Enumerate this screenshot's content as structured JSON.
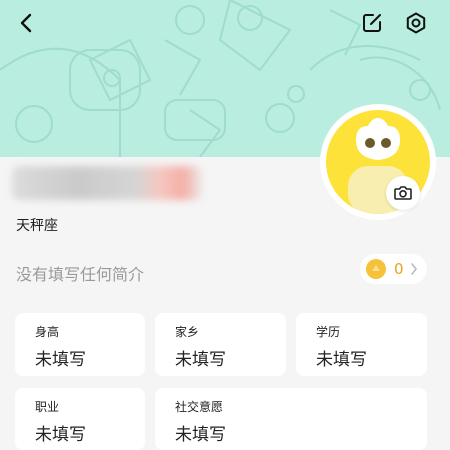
{
  "header": {
    "back_icon": "chevron-left-icon",
    "edit_icon": "edit-icon",
    "settings_icon": "settings-icon",
    "background_color": "#b8ede0"
  },
  "profile": {
    "zodiac": "天秤座",
    "bio_placeholder": "没有填写任何简介",
    "coin_count": "0",
    "avatar_color": "#fde23a",
    "camera_icon": "camera-icon"
  },
  "info_cards": [
    {
      "label": "身高",
      "value": "未填写"
    },
    {
      "label": "家乡",
      "value": "未填写"
    },
    {
      "label": "学历",
      "value": "未填写"
    },
    {
      "label": "职业",
      "value": "未填写"
    },
    {
      "label": "社交意愿",
      "value": "未填写"
    }
  ]
}
